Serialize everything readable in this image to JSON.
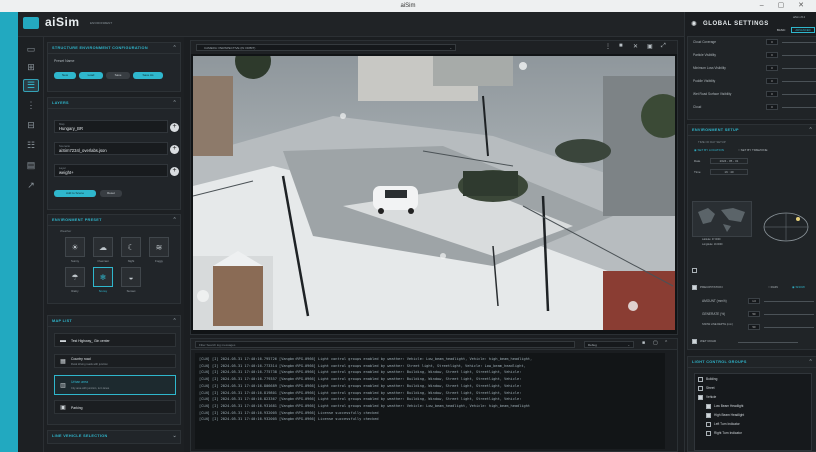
{
  "window": {
    "title": "aiSim"
  },
  "brand": {
    "name": "aiSim",
    "tag": "ENVIRONMENT"
  },
  "left": {
    "config": {
      "header": "STRUCTURE ENVIRONMENT CONFIGURATION",
      "preset_label": "Preset Name",
      "buttons": [
        "New",
        "Load",
        "Save",
        "Save As"
      ]
    },
    "layers": {
      "header": "LAYERS",
      "fields": [
        {
          "label": "Map",
          "value": "Hungary_BR"
        },
        {
          "label": "Scenario",
          "value": "aiSim7234l_overlabs.json"
        },
        {
          "label": "Layer",
          "value": "weight+"
        }
      ],
      "actions": [
        "Add to Scene",
        "Reset"
      ]
    },
    "weather": {
      "header": "ENVIRONMENT PRESET",
      "group_label": "Weather",
      "presets": [
        {
          "label": "Sunny",
          "icon": "sun-icon"
        },
        {
          "label": "Overcast",
          "icon": "cloud-icon"
        },
        {
          "label": "Night",
          "icon": "moon-icon"
        },
        {
          "label": "Foggy",
          "icon": "fog-icon"
        },
        {
          "label": "Rainy",
          "icon": "rain-icon"
        },
        {
          "label": "Snowy",
          "icon": "snow-icon"
        },
        {
          "label": "Sunset",
          "icon": "sunset-icon"
        }
      ]
    },
    "map_list": {
      "header": "MAP LIST",
      "items": [
        {
          "title": "Test Highway_ Gin center",
          "sub": ""
        },
        {
          "title": "Country road",
          "sub": "Rural driving roads with junction"
        },
        {
          "title": "Urban area",
          "sub": "City area with junction, turn lanes"
        },
        {
          "title": "Parking",
          "sub": ""
        }
      ]
    },
    "footer": {
      "header": "LINE VEHICLE SELECTION"
    }
  },
  "viewport": {
    "camera_select": "CAMERA: PERSPECTIVE (IN ORBIT)",
    "toolbar_icons": [
      "minimize-icon",
      "maximize-icon",
      "close-icon",
      "settings-icon",
      "fullscreen-icon"
    ]
  },
  "console": {
    "filter_placeholder": "Filter Search log messages",
    "level": "Debug",
    "lines": [
      "[CLN] [I] 2024-05-31 17:40:16.795726 [Vangbn:RPG-0966]   Light control groups enabled by weather: Vehicle: Low_beam_headlight, Vehicle: high_beam_headlight,",
      "[CLN] [I] 2024-05-31 17:40:16.773314 [Vangbn:RPG-0966]   Light control groups enabled by weather: Street light, Streetlight, Vehicle: Low_beam_headlight,",
      "[CLN] [I] 2024-05-31 17:40:16.775738 [Vangbn:RPG-0966]   Light control groups enabled by weather: Building, Window, Street light, Streetlight, Vehicle:",
      "[CLN] [I] 2024-05-31 17:40:16.779357 [Vangbn:RPG-0966]   Light control groups enabled by weather: Building, Window, Street light, Streetlight, Vehicle:",
      "[CLN] [I] 2024-05-31 17:40:16.806689 [Vangbn:RPG-0966]   Light control groups enabled by weather: Building, Window, Street light, Streetlight, Vehicle:",
      "[CLN] [I] 2024-05-31 17:40:16.819801 [Vangbn:RPG-0966]   Light control groups enabled by weather: Building, Window, Street light, Streetlight, Vehicle:",
      "[CLN] [I] 2024-05-31 17:40:16.823367 [Vangbn:RPG-0966]   Light control groups enabled by weather: Building, Window, Street light, Streetlight, Vehicle:",
      "[CLN] [I] 2024-05-31 17:40:16.931681 [Vangbn:RPG-0966]   Light control groups enabled by weather: Vehicle: Low_beam_headlight, Vehicle: high_beam_headlight",
      "[CLN] [I] 2024-05-31 17:40:16.932005 [Vangbn:RPG-0966]   License successfully checked",
      "[CLN] [I] 2024-05-31 17:40:16.932005 [Vangbn:RPG-0966]   License successfully checked"
    ]
  },
  "right": {
    "title": "GLOBAL SETTINGS",
    "version": "aiSim v5.2",
    "mode_tabs": [
      "BASIC",
      "ADVANCED"
    ],
    "sliders": [
      {
        "label": "Cloud Coverage",
        "value": "0"
      },
      {
        "label": "Particle Visibility",
        "value": "0"
      },
      {
        "label": "Minimum Loss Visibility",
        "value": "0"
      },
      {
        "label": "Puddle Visibility",
        "value": "0"
      },
      {
        "label": "Wet Road Surface Visibility",
        "value": "0"
      },
      {
        "label": "Cloud",
        "value": "0"
      }
    ],
    "env_setup": {
      "header": "ENVIRONMENT SETUP",
      "time_label": "TIME OF DAY SETUP",
      "modes": [
        "SET BY LOCATION",
        "SET BY TIMEZONE"
      ],
      "date_label": "Date",
      "date_value": "2024 - 05 - 31",
      "time_value_label": "Time",
      "time_value": "16 : 40",
      "lat": "Latitude: 47.0000",
      "lon": "Longitude: 19.0000"
    },
    "precip": {
      "label": "PRECIPITATION",
      "options": [
        "RAIN",
        "SNOW"
      ],
      "rows": [
        {
          "label": "AMOUNT (mm/h)",
          "value": "1.0"
        },
        {
          "label": "GENERATE (%)",
          "value": "50"
        },
        {
          "label": "SNOW LINE\nDEPTH (mm)",
          "value": "50"
        }
      ],
      "wet_label": "WET ROAD"
    },
    "lights": {
      "header": "LIGHT CONTROL GROUPS",
      "items": [
        {
          "label": "Building",
          "checked": false,
          "indent": 0
        },
        {
          "label": "Street",
          "checked": false,
          "indent": 0
        },
        {
          "label": "Vehicle",
          "checked": true,
          "indent": 0
        },
        {
          "label": "Low Beam Headlight",
          "checked": true,
          "indent": 1
        },
        {
          "label": "High Beam Headlight",
          "checked": true,
          "indent": 1
        },
        {
          "label": "Left Turn Indicator",
          "checked": false,
          "indent": 1
        },
        {
          "label": "Right Turn Indicator",
          "checked": false,
          "indent": 1
        }
      ]
    }
  },
  "colors": {
    "accent": "#2fb7cd",
    "strip": "#22a9c0"
  }
}
